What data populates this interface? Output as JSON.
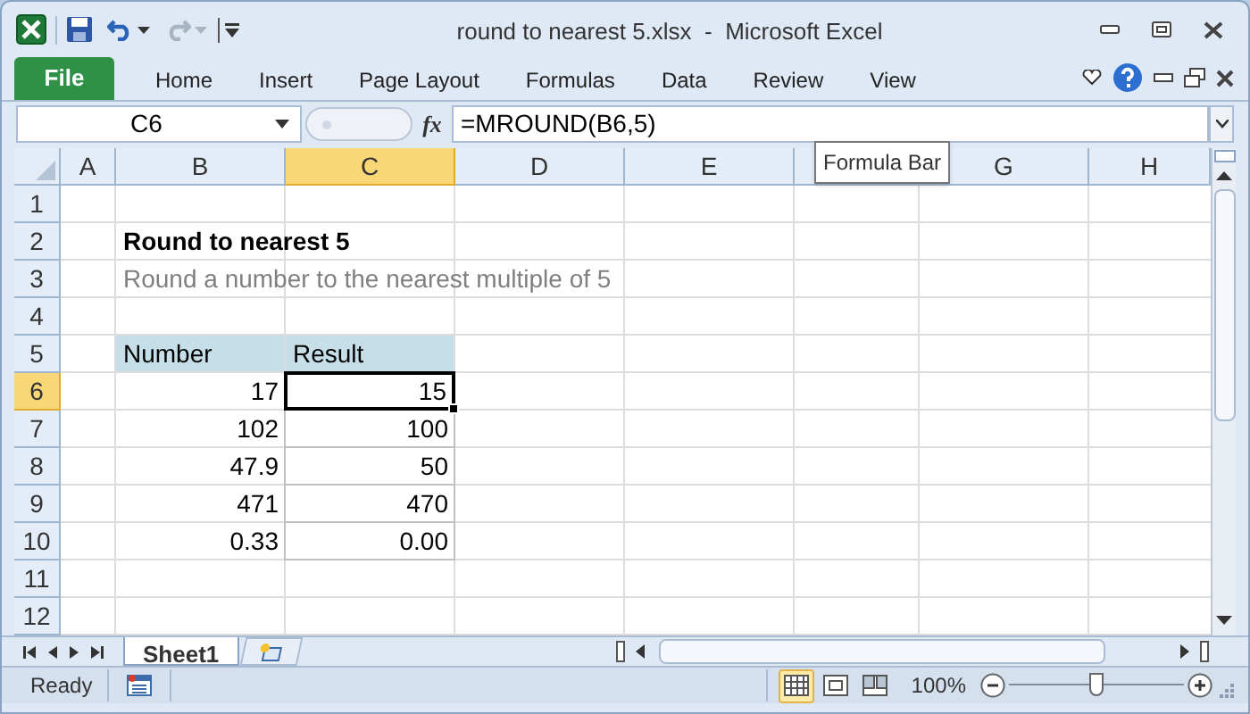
{
  "window": {
    "title": "round to nearest 5.xlsx  -  Microsoft Excel"
  },
  "ribbon": {
    "tabs": [
      {
        "label": "File",
        "kind": "file",
        "selected": false
      },
      {
        "label": "Home",
        "kind": "tab",
        "selected": false
      },
      {
        "label": "Insert",
        "kind": "tab",
        "selected": false
      },
      {
        "label": "Page Layout",
        "kind": "tab",
        "selected": false
      },
      {
        "label": "Formulas",
        "kind": "tab",
        "selected": false
      },
      {
        "label": "Data",
        "kind": "tab",
        "selected": false
      },
      {
        "label": "Review",
        "kind": "tab",
        "selected": false
      },
      {
        "label": "View",
        "kind": "tab",
        "selected": false
      }
    ]
  },
  "formula_bar": {
    "name_box": "C6",
    "function_label": "fx",
    "formula": "=MROUND(B6,5)"
  },
  "tooltip": "Formula Bar",
  "sheet": {
    "columns": [
      {
        "label": "A",
        "selected": false
      },
      {
        "label": "B",
        "selected": false
      },
      {
        "label": "C",
        "selected": true
      },
      {
        "label": "D",
        "selected": false
      },
      {
        "label": "E",
        "selected": false
      },
      {
        "selected": false
      },
      {
        "label": "G",
        "selected": false
      },
      {
        "label": "H",
        "selected": false
      }
    ],
    "rows": [
      {
        "label": "1",
        "selected": false
      },
      {
        "label": "2",
        "selected": false
      },
      {
        "label": "3",
        "selected": false
      },
      {
        "label": "4",
        "selected": false
      },
      {
        "label": "5",
        "selected": false
      },
      {
        "label": "6",
        "selected": true
      },
      {
        "label": "7",
        "selected": false
      },
      {
        "label": "8",
        "selected": false
      },
      {
        "label": "9",
        "selected": false
      },
      {
        "label": "10",
        "selected": false
      },
      {
        "label": "11",
        "selected": false
      },
      {
        "label": "12",
        "selected": false
      }
    ],
    "title": "Round to nearest 5",
    "subtitle": "Round a number to the nearest multiple of 5",
    "table": {
      "headers": [
        "Number",
        "Result"
      ],
      "rows": [
        {
          "number": "17",
          "result": "15",
          "result_selected": true
        },
        {
          "number": "102",
          "result": "100",
          "result_selected": false
        },
        {
          "number": "47.9",
          "result": "50",
          "result_selected": false
        },
        {
          "number": "471",
          "result": "470",
          "result_selected": false
        },
        {
          "number": "0.33",
          "result": "0.00",
          "result_selected": false
        }
      ]
    }
  },
  "sheet_tabs": [
    {
      "label": "Sheet1",
      "selected": true
    }
  ],
  "status_bar": {
    "status": "Ready",
    "views": [
      {
        "kind": "normal",
        "selected": true
      },
      {
        "kind": "page_layout",
        "selected": false
      },
      {
        "kind": "page_break",
        "selected": false
      }
    ],
    "zoom": "100%",
    "zoom_slider": {
      "level": 0.5
    }
  }
}
